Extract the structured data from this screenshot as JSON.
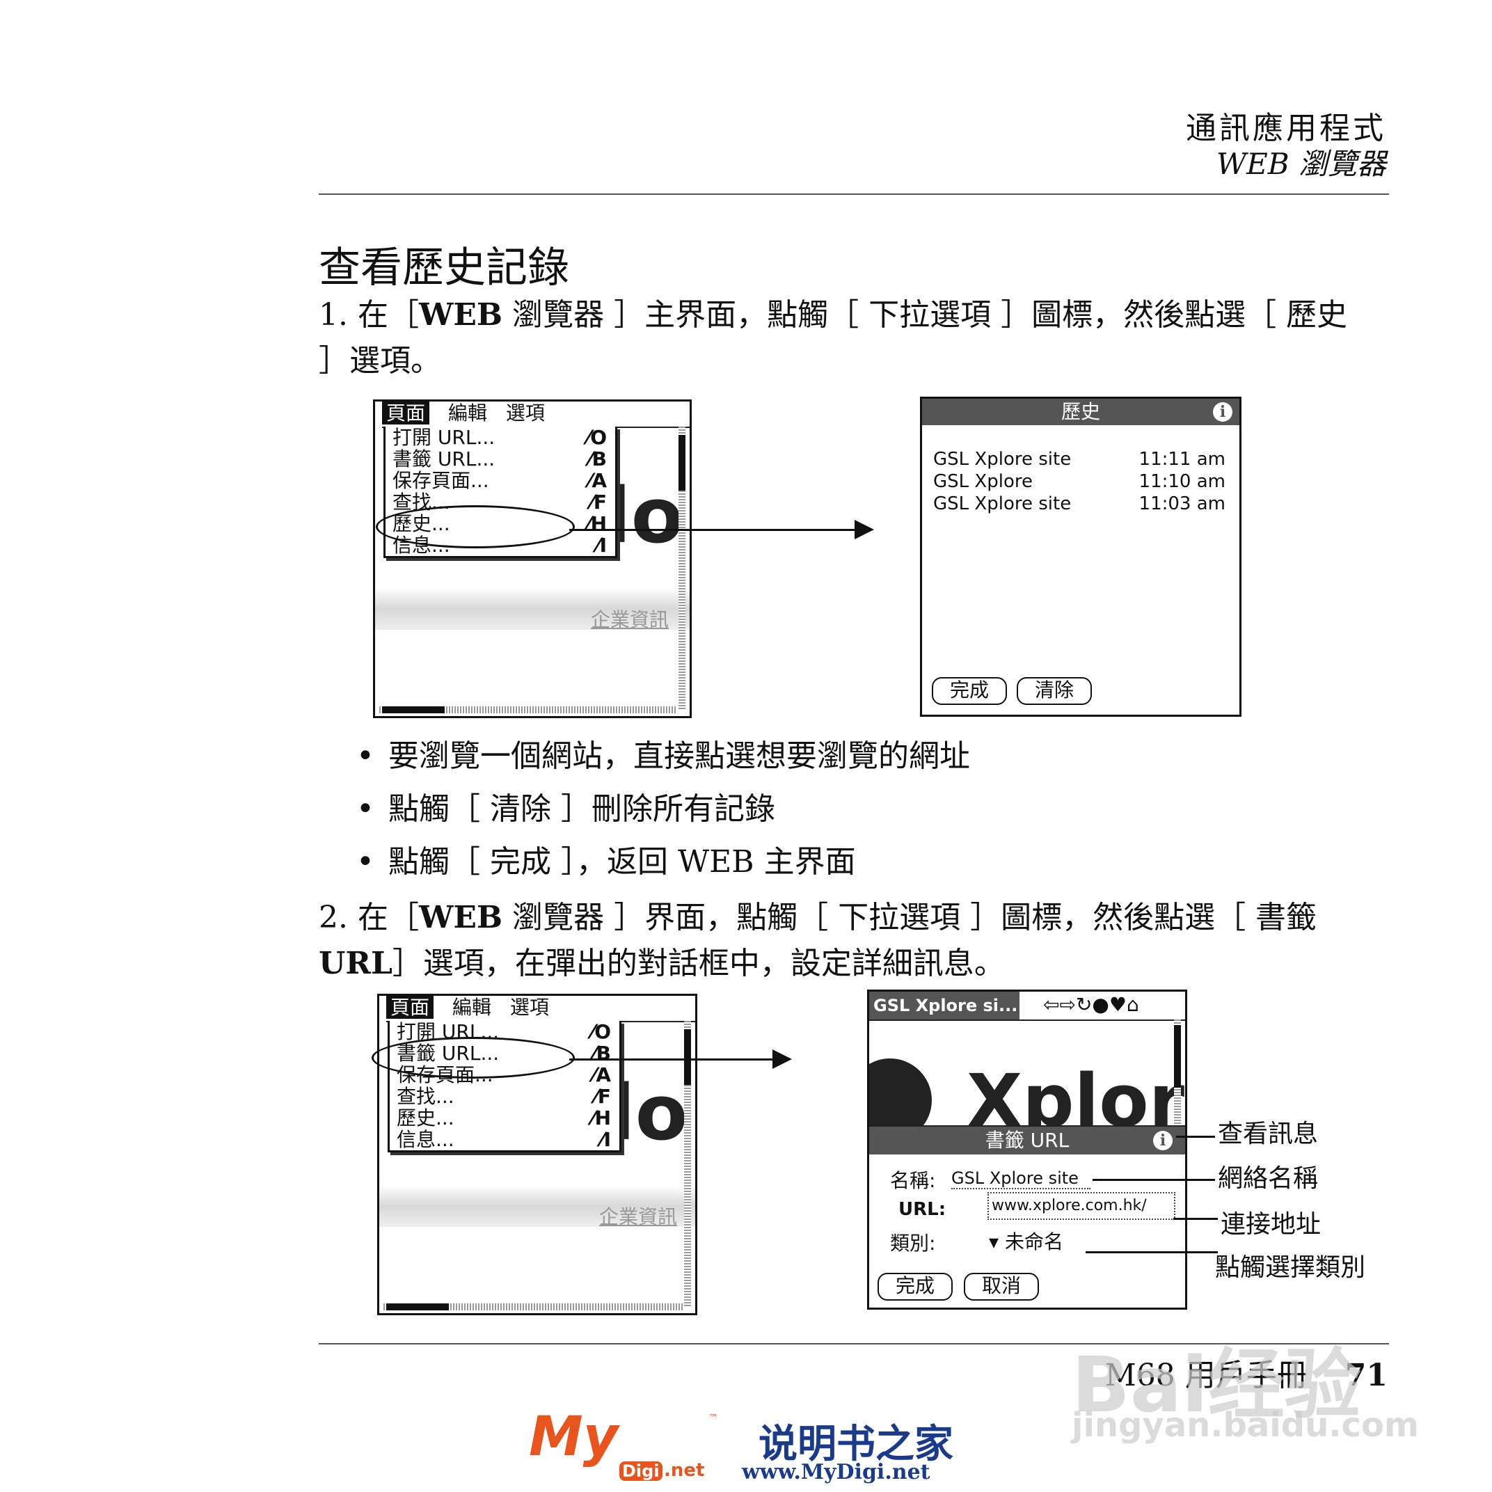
{
  "header": {
    "title": "通訊應用程式",
    "subtitle": "WEB 瀏覽器"
  },
  "section_title": "查看歷史記錄",
  "step1": {
    "num": "1.",
    "pre": "在［",
    "bold": "WEB",
    "post": " 瀏覽器 ］主界面，點觸［ 下拉選項 ］圖標，然後點選［ 歷史 ］選項。"
  },
  "bullets": [
    "要瀏覽一個網站，直接點選想要瀏覽的網址",
    "點觸［ 清除 ］刪除所有記錄",
    "點觸［ 完成 ］，返回 WEB 主界面"
  ],
  "bullet_dot": "•",
  "step2": {
    "num": "2.",
    "pre": "在［",
    "bold": "WEB",
    "mid": " 瀏覽器 ］界面，點觸［ 下拉選項 ］圖標，然後點選［ 書籤 ",
    "bold2": "URL",
    "post": "］選項，在彈出的對話框中，設定詳細訊息。"
  },
  "menu": {
    "bar": [
      "頁面",
      "編輯",
      "選項"
    ],
    "items": [
      {
        "label": "打開 URL...",
        "shortcut": "⁄O"
      },
      {
        "label": "書籤 URL...",
        "shortcut": "⁄B"
      },
      {
        "label": "保存頁面...",
        "shortcut": "⁄A"
      },
      {
        "label": "查找...",
        "shortcut": "⁄F"
      },
      {
        "label": "歷史...",
        "shortcut": "⁄H"
      },
      {
        "label": "信息...",
        "shortcut": "⁄I"
      }
    ],
    "bg_text": "lo",
    "link_text": "企業資訊"
  },
  "history_screen": {
    "title": "歷史",
    "rows": [
      {
        "site": "GSL Xplore site",
        "time": "11:11 am"
      },
      {
        "site": "GSL Xplore",
        "time": "11:10 am"
      },
      {
        "site": "GSL Xplore site",
        "time": "11:03 am"
      }
    ],
    "done_button": "完成",
    "clear_button": "清除"
  },
  "bookmark_screen": {
    "site_title": "GSL Xplore si...",
    "logo_text": "Xplor",
    "dialog_title": "書籤 URL",
    "name_label": "名稱:",
    "name_value": "GSL Xplore site",
    "url_label": "URL:",
    "url_value": "www.xplore.com.hk/",
    "category_label": "類別:",
    "category_value": "未命名",
    "done_button": "完成",
    "cancel_button": "取消"
  },
  "callouts": [
    "查看訊息",
    "網絡名稱",
    "連接地址",
    "點觸選擇類別"
  ],
  "footer": {
    "text": "M68 用戶手冊",
    "page": "71"
  },
  "watermark": {
    "logo": "My",
    "tm": "™",
    "digi": "Digi",
    "net": ".net",
    "title": "说明书之家",
    "url": "www.MyDigi.net",
    "baidu": "Bai",
    "baidu_cn": "经验",
    "jingyan": "jingyan.baidu.com"
  },
  "colors": {
    "titlebar": "#555555",
    "watermark_orange": "#e8541c",
    "watermark_blue": "#1a3a8c"
  }
}
